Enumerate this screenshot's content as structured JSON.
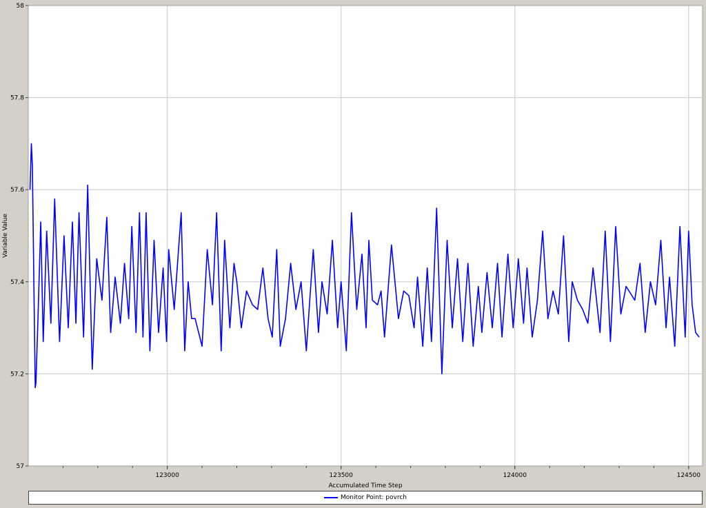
{
  "chart_data": {
    "type": "line",
    "title": "",
    "xlabel": "Accumulated Time Step",
    "ylabel": "Variable Value",
    "xlim": [
      122600,
      124540
    ],
    "ylim": [
      57.0,
      58.0
    ],
    "grid": true,
    "legend_position": "bottom",
    "x_ticks": [
      123000,
      123500,
      124000,
      124500
    ],
    "y_ticks": [
      57,
      57.2,
      57.4,
      57.6,
      57.8,
      58
    ],
    "y_tick_labels": [
      "57",
      "57.2",
      "57.4",
      "57.6",
      "57.8",
      "58"
    ],
    "series": [
      {
        "name": "Monitor Point: povrch",
        "color": "#0000ff",
        "x": [
          122605,
          122609,
          122612,
          122616,
          122620,
          122622,
          122628,
          122636,
          122643,
          122653,
          122665,
          122676,
          122690,
          122703,
          122715,
          122727,
          122737,
          122746,
          122759,
          122771,
          122784,
          122797,
          122812,
          122826,
          122837,
          122850,
          122865,
          122877,
          122889,
          122898,
          122910,
          122920,
          122930,
          122939,
          122950,
          122962,
          122975,
          122988,
          122998,
          123004,
          123020,
          123040,
          123050,
          123060,
          123070,
          123080,
          123100,
          123115,
          123130,
          123142,
          123155,
          123165,
          123180,
          123192,
          123200,
          123213,
          123228,
          123245,
          123260,
          123275,
          123290,
          123302,
          123315,
          123325,
          123340,
          123355,
          123370,
          123385,
          123400,
          123410,
          123420,
          123435,
          123445,
          123460,
          123475,
          123490,
          123500,
          123515,
          123530,
          123545,
          123560,
          123572,
          123580,
          123590,
          123605,
          123615,
          123625,
          123645,
          123665,
          123680,
          123695,
          123710,
          123720,
          123735,
          123748,
          123760,
          123775,
          123790,
          123805,
          123820,
          123835,
          123850,
          123865,
          123880,
          123895,
          123905,
          123920,
          123935,
          123950,
          123963,
          123980,
          123995,
          124010,
          124025,
          124035,
          124050,
          124065,
          124080,
          124095,
          124110,
          124125,
          124140,
          124155,
          124165,
          124180,
          124195,
          124210,
          124225,
          124245,
          124260,
          124275,
          124290,
          124305,
          124320,
          124345,
          124360,
          124375,
          124390,
          124405,
          124420,
          124435,
          124445,
          124460,
          124475,
          124490,
          124500,
          124510,
          124520,
          124530
        ],
        "values": [
          57.6,
          57.7,
          57.65,
          57.4,
          57.17,
          57.18,
          57.32,
          57.53,
          57.27,
          57.51,
          57.31,
          57.58,
          57.27,
          57.5,
          57.3,
          57.53,
          57.31,
          57.55,
          57.28,
          57.61,
          57.21,
          57.45,
          57.36,
          57.54,
          57.29,
          57.41,
          57.31,
          57.44,
          57.32,
          57.52,
          57.29,
          57.55,
          57.28,
          57.55,
          57.25,
          57.49,
          57.29,
          57.43,
          57.27,
          57.47,
          57.34,
          57.55,
          57.25,
          57.4,
          57.32,
          57.32,
          57.26,
          57.47,
          57.35,
          57.55,
          57.25,
          57.49,
          57.3,
          57.44,
          57.4,
          57.3,
          57.38,
          57.35,
          57.34,
          57.43,
          57.32,
          57.28,
          57.47,
          57.26,
          57.32,
          57.44,
          57.34,
          57.4,
          57.25,
          57.36,
          57.47,
          57.29,
          57.4,
          57.33,
          57.49,
          57.3,
          57.4,
          57.25,
          57.55,
          57.34,
          57.46,
          57.3,
          57.49,
          57.36,
          57.35,
          57.38,
          57.28,
          57.48,
          57.32,
          57.38,
          57.37,
          57.3,
          57.41,
          57.26,
          57.43,
          57.27,
          57.56,
          57.2,
          57.49,
          57.3,
          57.45,
          57.27,
          57.44,
          57.26,
          57.39,
          57.29,
          57.42,
          57.3,
          57.44,
          57.28,
          57.46,
          57.3,
          57.45,
          57.31,
          57.43,
          57.28,
          57.36,
          57.51,
          57.32,
          57.38,
          57.33,
          57.5,
          57.27,
          57.4,
          57.36,
          57.34,
          57.31,
          57.43,
          57.29,
          57.51,
          57.27,
          57.52,
          57.33,
          57.39,
          57.36,
          57.44,
          57.29,
          57.4,
          57.35,
          57.49,
          57.3,
          57.41,
          57.26,
          57.52,
          57.28,
          57.51,
          57.35,
          57.29,
          57.28
        ]
      }
    ]
  }
}
